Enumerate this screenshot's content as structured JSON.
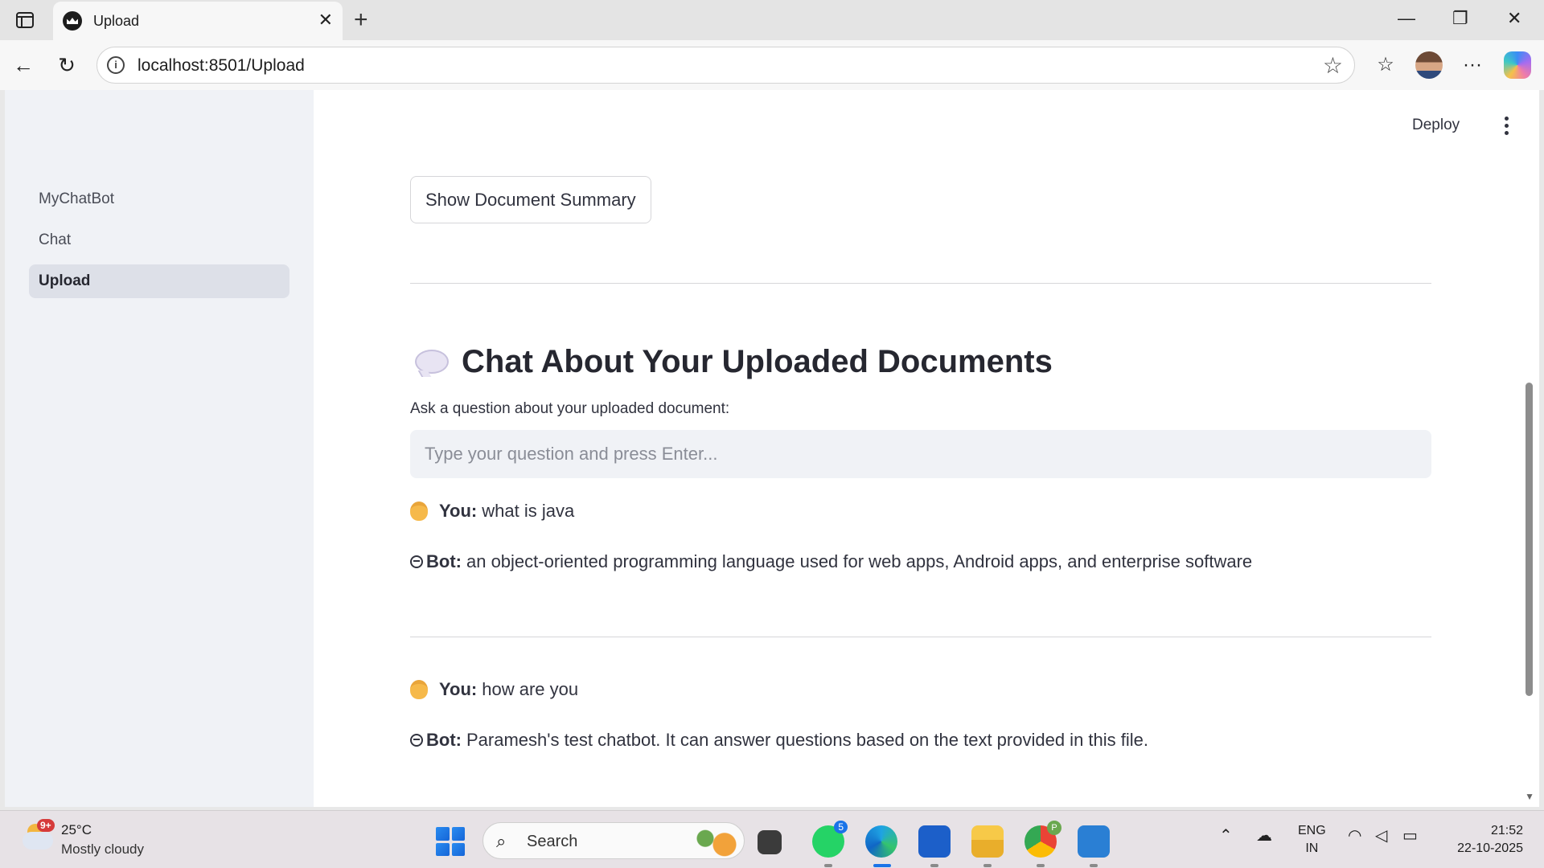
{
  "browser": {
    "tab_title": "Upload",
    "url": "localhost:8501/Upload"
  },
  "sidebar": {
    "items": [
      {
        "label": "MyChatBot",
        "active": false
      },
      {
        "label": "Chat",
        "active": false
      },
      {
        "label": "Upload",
        "active": true
      }
    ]
  },
  "header": {
    "deploy_label": "Deploy"
  },
  "main": {
    "summary_button": "Show Document Summary",
    "chat_heading": "Chat About Your Uploaded Documents",
    "question_label": "Ask a question about your uploaded document:",
    "question_placeholder": "Type your question and press Enter...",
    "messages": [
      {
        "you_label": "You:",
        "you_text": "what is java",
        "bot_label": "Bot:",
        "bot_text": "an object-oriented programming language used for web apps, Android apps, and enterprise software"
      },
      {
        "you_label": "You:",
        "you_text": "how are you",
        "bot_label": "Bot:",
        "bot_text": "Paramesh's test chatbot. It can answer questions based on the text provided in this file."
      }
    ]
  },
  "taskbar": {
    "weather_badge": "9+",
    "temperature": "25°C",
    "condition": "Mostly cloudy",
    "search_label": "Search",
    "whatsapp_badge": "5",
    "chrome_badge": "P",
    "lang_line1": "ENG",
    "lang_line2": "IN",
    "time": "21:52",
    "date": "22-10-2025"
  },
  "colors": {
    "sidebar_bg": "#f0f2f6",
    "active_item_bg": "#dde0e8",
    "text": "#31333f"
  }
}
